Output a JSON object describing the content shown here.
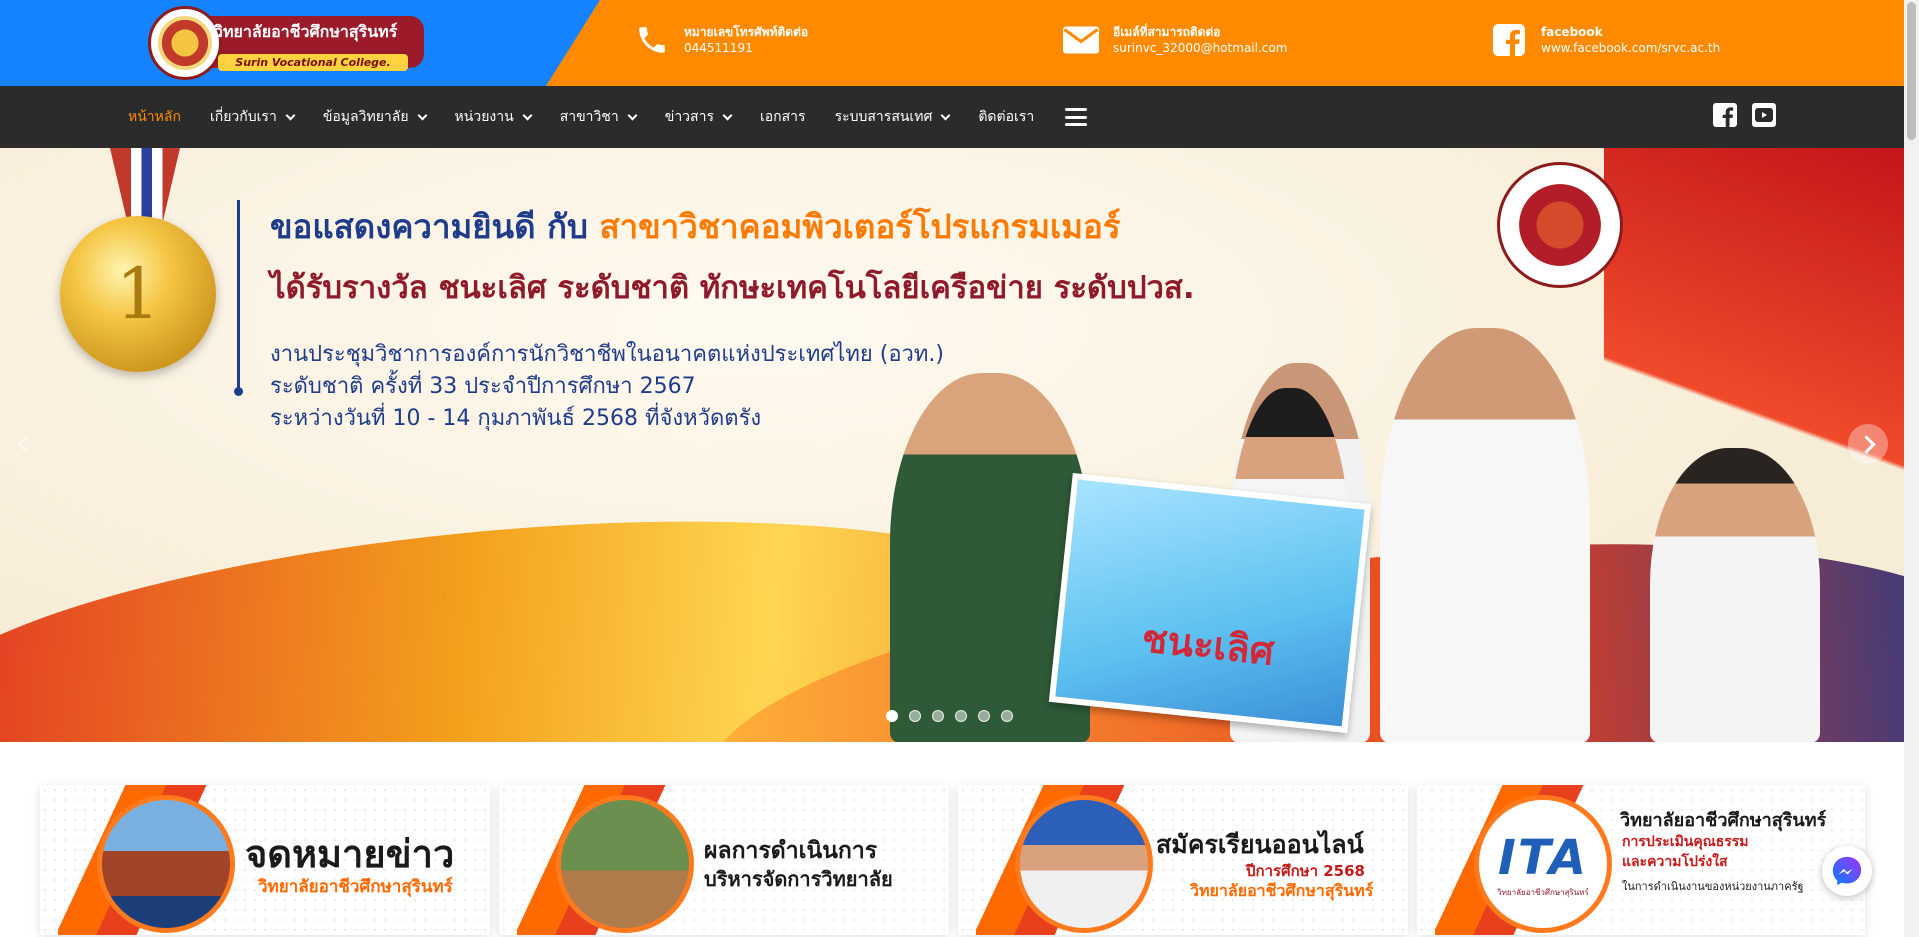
{
  "header": {
    "college_name": "วิทยาลัยอาชีวศึกษาสุรินทร์",
    "college_name_en": "Surin Vocational College.",
    "contacts": [
      {
        "icon": "phone-icon",
        "title": "หมายเลขโทรศัพท์ติดต่อ",
        "value": "044511191"
      },
      {
        "icon": "email-icon",
        "title": "อีเมล์ที่สามารถติดต่อ",
        "value": "surinvc_32000@hotmail.com"
      },
      {
        "icon": "facebook-icon",
        "title": "facebook",
        "value": "www.facebook.com/srvc.ac.th"
      }
    ]
  },
  "nav": {
    "items": [
      {
        "label": "หน้าหลัก",
        "dropdown": false,
        "active": true
      },
      {
        "label": "เกี่ยวกับเรา",
        "dropdown": true
      },
      {
        "label": "ข้อมูลวิทยาลัย",
        "dropdown": true
      },
      {
        "label": "หน่วยงาน",
        "dropdown": true
      },
      {
        "label": "สาขาวิชา",
        "dropdown": true
      },
      {
        "label": "ข่าวสาร",
        "dropdown": true
      },
      {
        "label": "เอกสาร",
        "dropdown": false
      },
      {
        "label": "ระบบสารสนเทศ",
        "dropdown": true
      },
      {
        "label": "ติดต่อเรา",
        "dropdown": false
      }
    ],
    "social": [
      "facebook-square-icon",
      "youtube-icon"
    ]
  },
  "banner": {
    "medal_number": "1",
    "headline_prefix": "ขอแสดงความยินดี กับ ",
    "headline_highlight": "สาขาวิชาคอมพิวเตอร์โปรแกรมเมอร์",
    "subheadline": "ได้รับรางวัล ชนะเลิศ ระดับชาติ ทักษะเทคโนโลยีเครือข่าย ระดับปวส.",
    "info_lines": [
      "งานประชุมวิชาการองค์การนักวิชาชีพในอนาคตแห่งประเทศไทย (อวท.)",
      "ระดับชาติ ครั้งที่ 33 ประจำปีการศึกษา 2567",
      "ระหว่างวันที่ 10 - 14 กุมภาพันธ์ 2568 ที่จังหวัดตรัง"
    ],
    "award_text": "ชนะเลิศ",
    "slide_count": 6,
    "active_slide": 1
  },
  "cards": [
    {
      "line1": "จดหมายข่าว",
      "line2": "วิทยาลัยอาชีวศึกษาสุรินทร์"
    },
    {
      "line1": "ผลการดำเนินการ",
      "line2": "บริหารจัดการวิทยาลัย"
    },
    {
      "line1": "สมัครเรียนออนไลน์",
      "line2": "ปีการศึกษา 2568",
      "line3": "วิทยาลัยอาชีวศึกษาสุรินทร์"
    },
    {
      "line1": "วิทยาลัยอาชีวศึกษาสุรินทร์",
      "line2": "การประเมินคุณธรรม",
      "line3": "และความโปร่งใส",
      "line4": "ในการดำเนินงานของหน่วยงานภาครัฐ",
      "badge": "ITA",
      "badge_caption": "วิทยาลัยอาชีวศึกษาสุรินทร์"
    }
  ],
  "colors": {
    "orange": "#ff8a00",
    "blue": "#1583ff",
    "nav_bg": "#2b2b2b",
    "navy": "#1f3c8a",
    "maroon": "#8f1a2a"
  }
}
